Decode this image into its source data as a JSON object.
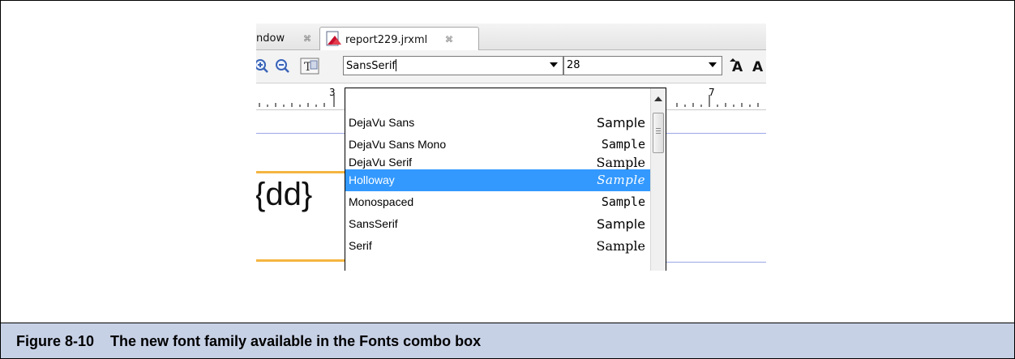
{
  "tabs": {
    "prev_label": "ndow",
    "close_glyph": "⌘",
    "active_label": "report229.jrxml"
  },
  "toolbar": {
    "font_value": "SansSerif",
    "size_value": "28",
    "bold_a": "A"
  },
  "ruler": {
    "left_number": "3",
    "right_number": "7"
  },
  "canvas": {
    "field_text": "{dd}"
  },
  "font_list": [
    {
      "name": "DejaVu Sans",
      "sample": "Sample",
      "style": "sans"
    },
    {
      "name": "DejaVu Sans Mono",
      "sample": "Sample",
      "style": "mono"
    },
    {
      "name": "DejaVu Serif",
      "sample": "Sample",
      "style": "serif"
    },
    {
      "name": "Holloway",
      "sample": "Sample",
      "style": "script",
      "selected": true
    },
    {
      "name": "Monospaced",
      "sample": "Sample",
      "style": "mono"
    },
    {
      "name": "SansSerif",
      "sample": "Sample",
      "style": "sans"
    },
    {
      "name": "Serif",
      "sample": "Sample",
      "style": "serif"
    }
  ],
  "caption": {
    "text": "Figure 8-10    The new font family available in the Fonts combo box"
  },
  "colors": {
    "selection": "#3399ff",
    "caption_bg": "#c7d1e6",
    "guide_orange": "#f5b540",
    "guide_blue": "#9aa6e6"
  }
}
